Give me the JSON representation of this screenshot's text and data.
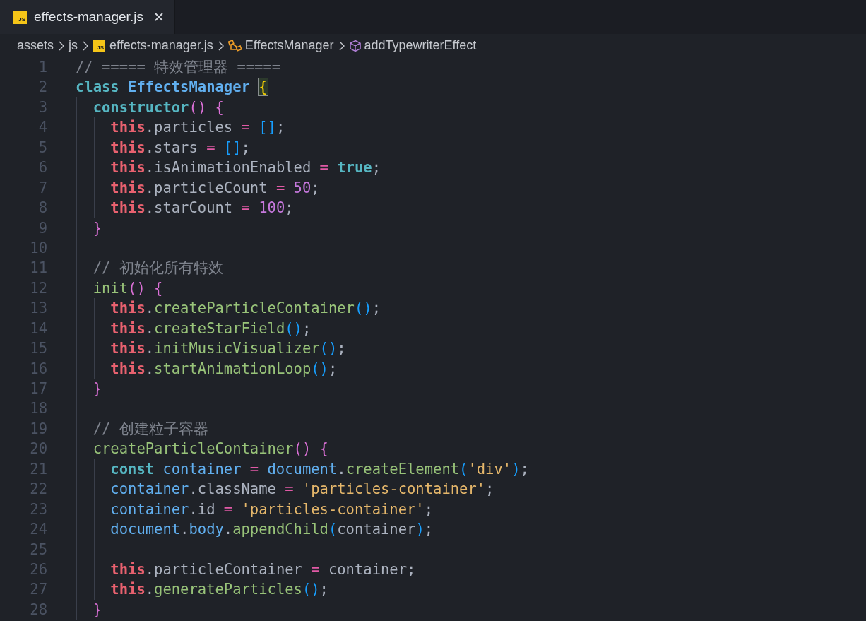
{
  "tabs": [
    {
      "label": "effects-manager.js",
      "icon_text": "JS",
      "selected": true
    }
  ],
  "breadcrumb": [
    {
      "label": "assets",
      "kind": "folder"
    },
    {
      "label": "js",
      "kind": "folder"
    },
    {
      "label": "effects-manager.js",
      "kind": "file",
      "icon_text": "JS"
    },
    {
      "label": "EffectsManager",
      "kind": "class"
    },
    {
      "label": "addTypewriterEffect",
      "kind": "method"
    }
  ],
  "lines": [
    {
      "number": "1",
      "tokens": [
        {
          "text": "// ===== 特效管理器 =====",
          "kind": "comment"
        }
      ]
    },
    {
      "number": "2",
      "tokens": [
        {
          "text": "class ",
          "kind": "keyword"
        },
        {
          "text": "EffectsManager ",
          "kind": "classname"
        },
        {
          "text": "{",
          "kind": "bracket1",
          "matched": true
        }
      ]
    },
    {
      "number": "3",
      "tokens": [
        {
          "text": "  constructor",
          "kind": "keywordfn"
        },
        {
          "text": "()",
          "kind": "bracket2"
        },
        {
          "text": " {",
          "kind": "bracket2"
        }
      ]
    },
    {
      "number": "4",
      "tokens": [
        {
          "text": "    this",
          "kind": "self"
        },
        {
          "text": ".particles ",
          "kind": "plain"
        },
        {
          "text": "= ",
          "kind": "operator"
        },
        {
          "text": "[]",
          "kind": "bracket3"
        },
        {
          "text": ";",
          "kind": "plain"
        }
      ]
    },
    {
      "number": "5",
      "tokens": [
        {
          "text": "    this",
          "kind": "self"
        },
        {
          "text": ".stars ",
          "kind": "plain"
        },
        {
          "text": "= ",
          "kind": "operator"
        },
        {
          "text": "[]",
          "kind": "bracket3"
        },
        {
          "text": ";",
          "kind": "plain"
        }
      ]
    },
    {
      "number": "6",
      "tokens": [
        {
          "text": "    this",
          "kind": "self"
        },
        {
          "text": ".isAnimationEnabled ",
          "kind": "plain"
        },
        {
          "text": "= ",
          "kind": "operator"
        },
        {
          "text": "true",
          "kind": "keyword"
        },
        {
          "text": ";",
          "kind": "plain"
        }
      ]
    },
    {
      "number": "7",
      "tokens": [
        {
          "text": "    this",
          "kind": "self"
        },
        {
          "text": ".particleCount ",
          "kind": "plain"
        },
        {
          "text": "= ",
          "kind": "operator"
        },
        {
          "text": "50",
          "kind": "number"
        },
        {
          "text": ";",
          "kind": "plain"
        }
      ]
    },
    {
      "number": "8",
      "tokens": [
        {
          "text": "    this",
          "kind": "self"
        },
        {
          "text": ".starCount ",
          "kind": "plain"
        },
        {
          "text": "= ",
          "kind": "operator"
        },
        {
          "text": "100",
          "kind": "number"
        },
        {
          "text": ";",
          "kind": "plain"
        }
      ]
    },
    {
      "number": "9",
      "tokens": [
        {
          "text": "  }",
          "kind": "bracket2"
        }
      ]
    },
    {
      "number": "10"
    },
    {
      "number": "11",
      "tokens": [
        {
          "text": "  // 初始化所有特效",
          "kind": "comment"
        }
      ]
    },
    {
      "number": "12",
      "tokens": [
        {
          "text": "  init",
          "kind": "function"
        },
        {
          "text": "()",
          "kind": "bracket2"
        },
        {
          "text": " {",
          "kind": "bracket2"
        }
      ]
    },
    {
      "number": "13",
      "tokens": [
        {
          "text": "    this",
          "kind": "self"
        },
        {
          "text": ".",
          "kind": "plain"
        },
        {
          "text": "createParticleContainer",
          "kind": "function"
        },
        {
          "text": "()",
          "kind": "bracket3"
        },
        {
          "text": ";",
          "kind": "plain"
        }
      ]
    },
    {
      "number": "14",
      "tokens": [
        {
          "text": "    this",
          "kind": "self"
        },
        {
          "text": ".",
          "kind": "plain"
        },
        {
          "text": "createStarField",
          "kind": "function"
        },
        {
          "text": "()",
          "kind": "bracket3"
        },
        {
          "text": ";",
          "kind": "plain"
        }
      ]
    },
    {
      "number": "15",
      "tokens": [
        {
          "text": "    this",
          "kind": "self"
        },
        {
          "text": ".",
          "kind": "plain"
        },
        {
          "text": "initMusicVisualizer",
          "kind": "function"
        },
        {
          "text": "()",
          "kind": "bracket3"
        },
        {
          "text": ";",
          "kind": "plain"
        }
      ]
    },
    {
      "number": "16",
      "tokens": [
        {
          "text": "    this",
          "kind": "self"
        },
        {
          "text": ".",
          "kind": "plain"
        },
        {
          "text": "startAnimationLoop",
          "kind": "function"
        },
        {
          "text": "()",
          "kind": "bracket3"
        },
        {
          "text": ";",
          "kind": "plain"
        }
      ]
    },
    {
      "number": "17",
      "tokens": [
        {
          "text": "  }",
          "kind": "bracket2"
        }
      ]
    },
    {
      "number": "18"
    },
    {
      "number": "19",
      "tokens": [
        {
          "text": "  // 创建粒子容器",
          "kind": "comment"
        }
      ]
    },
    {
      "number": "20",
      "tokens": [
        {
          "text": "  createParticleContainer",
          "kind": "function"
        },
        {
          "text": "()",
          "kind": "bracket2"
        },
        {
          "text": " {",
          "kind": "bracket2"
        }
      ]
    },
    {
      "number": "21",
      "tokens": [
        {
          "text": "    const ",
          "kind": "keyword"
        },
        {
          "text": "container ",
          "kind": "variable"
        },
        {
          "text": "= ",
          "kind": "operator"
        },
        {
          "text": "document",
          "kind": "variable"
        },
        {
          "text": ".",
          "kind": "plain"
        },
        {
          "text": "createElement",
          "kind": "function"
        },
        {
          "text": "(",
          "kind": "bracket3"
        },
        {
          "text": "'div'",
          "kind": "string"
        },
        {
          "text": ")",
          "kind": "bracket3"
        },
        {
          "text": ";",
          "kind": "plain"
        }
      ]
    },
    {
      "number": "22",
      "tokens": [
        {
          "text": "    container",
          "kind": "variable"
        },
        {
          "text": ".className ",
          "kind": "plain"
        },
        {
          "text": "= ",
          "kind": "operator"
        },
        {
          "text": "'particles-container'",
          "kind": "string"
        },
        {
          "text": ";",
          "kind": "plain"
        }
      ]
    },
    {
      "number": "23",
      "tokens": [
        {
          "text": "    container",
          "kind": "variable"
        },
        {
          "text": ".id ",
          "kind": "plain"
        },
        {
          "text": "= ",
          "kind": "operator"
        },
        {
          "text": "'particles-container'",
          "kind": "string"
        },
        {
          "text": ";",
          "kind": "plain"
        }
      ]
    },
    {
      "number": "24",
      "tokens": [
        {
          "text": "    document",
          "kind": "variable"
        },
        {
          "text": ".",
          "kind": "plain"
        },
        {
          "text": "body",
          "kind": "variable"
        },
        {
          "text": ".",
          "kind": "plain"
        },
        {
          "text": "appendChild",
          "kind": "function"
        },
        {
          "text": "(",
          "kind": "bracket3"
        },
        {
          "text": "container",
          "kind": "plain"
        },
        {
          "text": ")",
          "kind": "bracket3"
        },
        {
          "text": ";",
          "kind": "plain"
        }
      ]
    },
    {
      "number": "25"
    },
    {
      "number": "26",
      "tokens": [
        {
          "text": "    this",
          "kind": "self"
        },
        {
          "text": ".particleContainer ",
          "kind": "plain"
        },
        {
          "text": "= ",
          "kind": "operator"
        },
        {
          "text": "container;",
          "kind": "plain"
        }
      ]
    },
    {
      "number": "27",
      "tokens": [
        {
          "text": "    this",
          "kind": "self"
        },
        {
          "text": ".",
          "kind": "plain"
        },
        {
          "text": "generateParticles",
          "kind": "function"
        },
        {
          "text": "()",
          "kind": "bracket3"
        },
        {
          "text": ";",
          "kind": "plain"
        }
      ]
    },
    {
      "number": "28",
      "tokens": [
        {
          "text": "  }",
          "kind": "bracket2"
        }
      ]
    }
  ]
}
